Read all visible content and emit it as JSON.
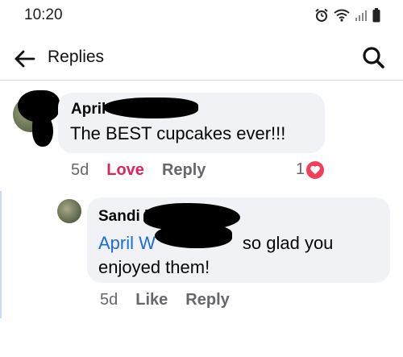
{
  "status_bar": {
    "time": "10:20",
    "icons": [
      "alarm-icon",
      "wifi-icon",
      "signal-icon",
      "battery-icon"
    ]
  },
  "header": {
    "title": "Replies",
    "back_icon": "arrow-left-icon",
    "search_icon": "search-icon"
  },
  "comment": {
    "author": "April Willi",
    "text": "The BEST cupcakes ever!!!",
    "time": "5d",
    "reaction_label": "Love",
    "reply_label": "Reply",
    "reaction_count": "1",
    "reaction_icon": "heart-icon",
    "reaction_color": "#f33e58"
  },
  "reply": {
    "author": "Sandi l",
    "mention": "April W",
    "text": "so glad you enjoyed them!",
    "time": "5d",
    "like_label": "Like",
    "reply_label": "Reply"
  },
  "colors": {
    "mention": "#1a6dd6",
    "love": "#e0245e",
    "bubble": "#f0f2f5"
  }
}
